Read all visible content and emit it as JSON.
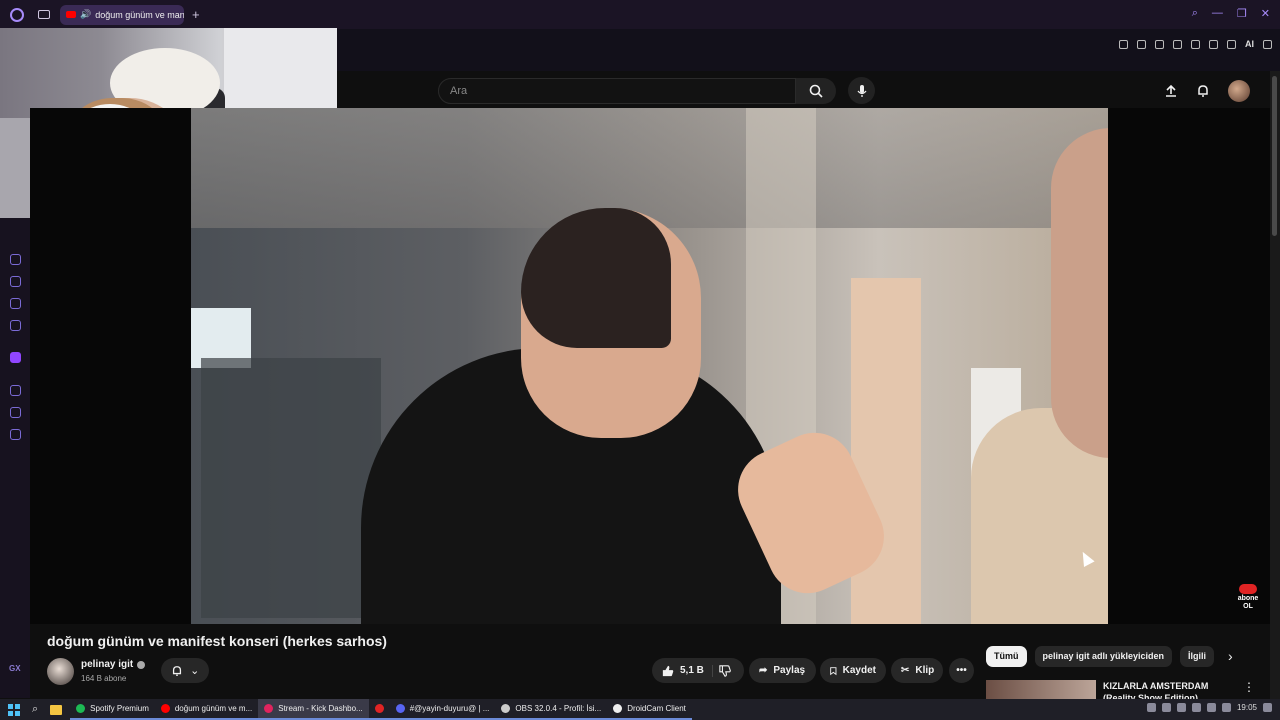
{
  "browser": {
    "tab_title": "doğum günüm ve manifest konseri (herkes sarhos)",
    "new_tab": "+",
    "ext_ai": "AI"
  },
  "youtube": {
    "search_placeholder": "Ara",
    "video": {
      "title": "doğum günüm ve manifest konseri (herkes sarhos)",
      "channel": "pelinay igit",
      "subscribers": "164 B abone",
      "likes": "5,1 B",
      "share": "Paylaş",
      "save": "Kaydet",
      "clip": "Klip",
      "more": "•••"
    },
    "overlay_badge": {
      "line1": "abone",
      "line2": "OL"
    },
    "chips": [
      "Tümü",
      "pelinay igit adlı yükleyiciden",
      "İlgili"
    ],
    "recommendation": {
      "title": "KIZLARLA AMSTERDAM",
      "subtitle": "(Reality Show Edition)"
    }
  },
  "taskbar": {
    "apps": [
      {
        "label": "Spotify Premium",
        "color": "#1db954"
      },
      {
        "label": "doğum günüm ve m...",
        "color": "#ff0000"
      },
      {
        "label": "Stream - Kick Dashbo...",
        "color": "#e0245e"
      },
      {
        "label": "",
        "color": "#e02424"
      },
      {
        "label": "#@yayin-duyuru@ | ...",
        "color": "#5865f2"
      },
      {
        "label": "OBS 32.0.4 - Profil: İsi...",
        "color": "#cccccc"
      },
      {
        "label": "DroidCam Client",
        "color": "#eeeeee"
      }
    ],
    "clock": "19:05"
  }
}
